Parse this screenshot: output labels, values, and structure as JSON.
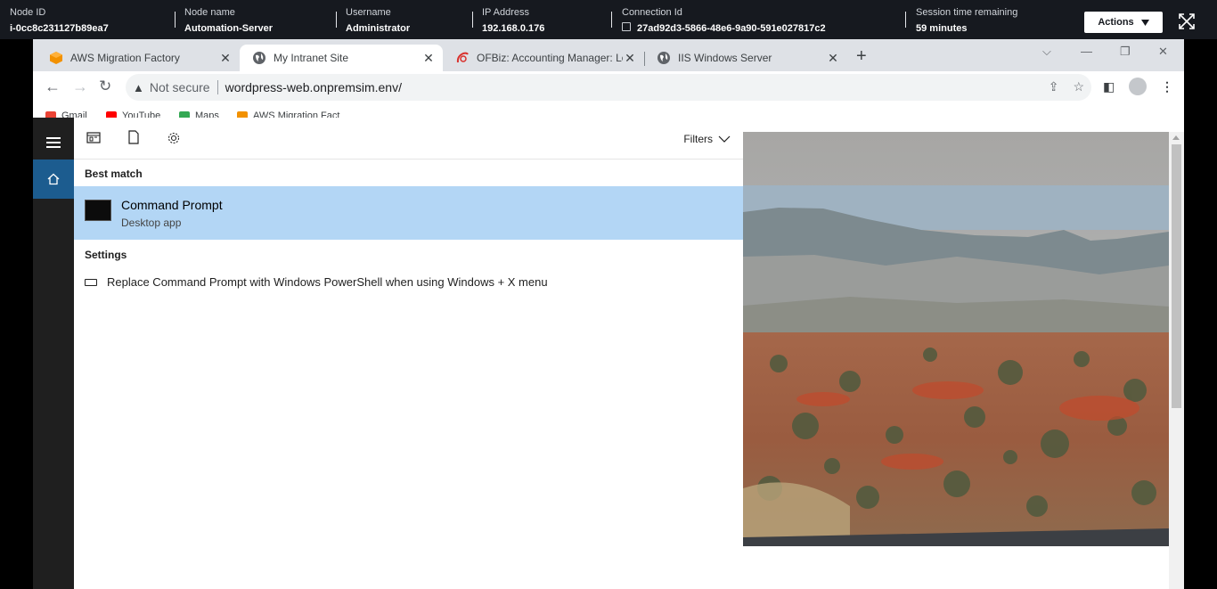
{
  "session": {
    "node_id_label": "Node ID",
    "node_id": "i-0cc8c231127b89ea7",
    "node_name_label": "Node name",
    "node_name": "Automation-Server",
    "username_label": "Username",
    "username": "Administrator",
    "ip_label": "IP Address",
    "ip": "192.168.0.176",
    "connection_label": "Connection Id",
    "connection_id": "27ad92d3-5866-48e6-9a90-591e027817c2",
    "time_label": "Session time remaining",
    "time_remaining": "59 minutes",
    "actions_label": "Actions"
  },
  "browser": {
    "tabs": [
      {
        "title": "AWS Migration Factory",
        "icon": "aws-cube-icon",
        "color": "#f29100"
      },
      {
        "title": "My Intranet Site",
        "icon": "globe-icon",
        "active": true
      },
      {
        "title": "OFBiz: Accounting Manager: Logi",
        "icon": "ofbiz-icon",
        "color": "#d9302c"
      },
      {
        "title": "IIS Windows Server",
        "icon": "globe-icon"
      }
    ],
    "security_label": "Not secure",
    "url": "wordpress-web.onpremsim.env/",
    "bookmarks": [
      {
        "label": "Gmail",
        "color": "#ea4335"
      },
      {
        "label": "YouTube",
        "color": "#ff0000"
      },
      {
        "label": "Maps",
        "color": "#34a853"
      },
      {
        "label": "AWS Migration Fact",
        "color": "#f29100"
      }
    ]
  },
  "search": {
    "filters_label": "Filters",
    "best_match_heading": "Best match",
    "best_match": {
      "title": "Command Prompt",
      "subtitle": "Desktop app"
    },
    "settings_heading": "Settings",
    "settings_item": "Replace Command Prompt with Windows PowerShell when using Windows + X menu"
  },
  "colors": {
    "ssm_bar": "#16191f",
    "selected_result": "#b3d6f5",
    "home_button": "#1c5c8f",
    "rail": "#1f1f1f"
  }
}
